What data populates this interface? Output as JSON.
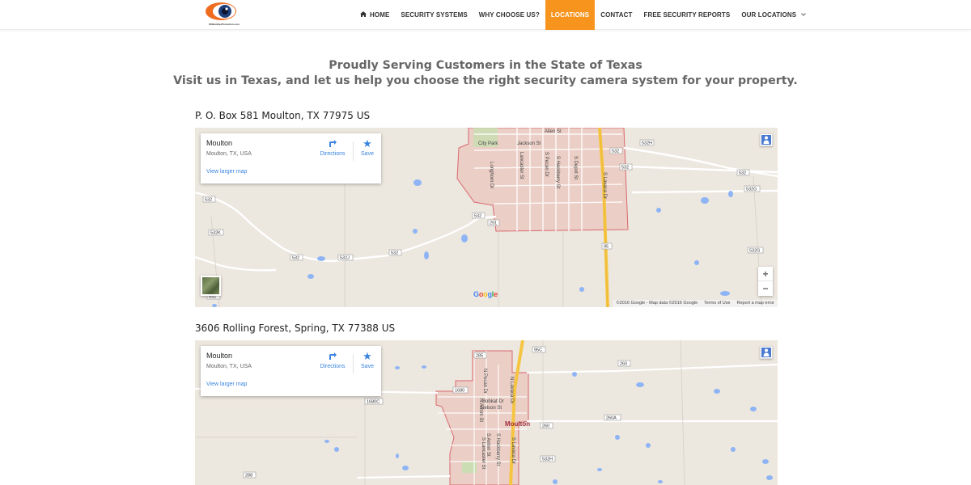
{
  "header": {
    "logo_tagline": "WilliamEyeProtection.com",
    "nav": [
      {
        "label": "HOME",
        "icon": "home-icon"
      },
      {
        "label": "SECURITY SYSTEMS"
      },
      {
        "label": "WHY CHOOSE US?"
      },
      {
        "label": "LOCATIONS",
        "active": true
      },
      {
        "label": "CONTACT"
      },
      {
        "label": "FREE SECURITY REPORTS"
      },
      {
        "label": "OUR LOCATIONS",
        "icon": "chevron-down-icon"
      }
    ],
    "accent_color": "#f7941d"
  },
  "intro": {
    "line1": "Proudly Serving Customers in the State of Texas",
    "line2": "Visit us in Texas, and let us help you choose the right security camera system for your property."
  },
  "locations": [
    {
      "address": "P. O. Box 581 Moulton, TX 77975 US",
      "map": {
        "place_name": "Moulton",
        "place_sub": "Moulton, TX, USA",
        "directions_label": "Directions",
        "save_label": "Save",
        "larger_map_label": "View larger map",
        "google_label": "Google",
        "attribution": [
          "©2016 Google - Map data ©2016 Google",
          "Terms of Use",
          "Report a map error"
        ],
        "zoom_in": "+",
        "zoom_out": "−",
        "street_labels": [
          "City Park",
          "Jackson St",
          "Allen St",
          "Lancaster St",
          "S Pecan Dr",
          "S Hackberry St",
          "S Depot St",
          "S Lavaca Dr",
          "Longhorn Dr"
        ],
        "route_shields": [
          "532",
          "532H",
          "532",
          "532",
          "532G",
          "532",
          "532K",
          "532",
          "532J",
          "532",
          "291",
          "95",
          "532G",
          "532"
        ]
      }
    },
    {
      "address": "3606 Rolling Forest, Spring, TX 77388 US",
      "map": {
        "place_name": "Moulton",
        "place_sub": "Moulton, TX, USA",
        "directions_label": "Directions",
        "save_label": "Save",
        "larger_map_label": "View larger map",
        "town_label": "Moulton",
        "street_labels": [
          "N Pecan Dr",
          "N Lavaca Dr",
          "N Armm St",
          "Bobkat Dr",
          "Nelson St",
          "S Armm St",
          "S Hackberry St",
          "S Lancaster St",
          "S Lavaca Dr"
        ],
        "route_shields": [
          "285",
          "95C",
          "1680",
          "1680C",
          "260",
          "260A",
          "260",
          "532H",
          "288"
        ]
      }
    }
  ]
}
